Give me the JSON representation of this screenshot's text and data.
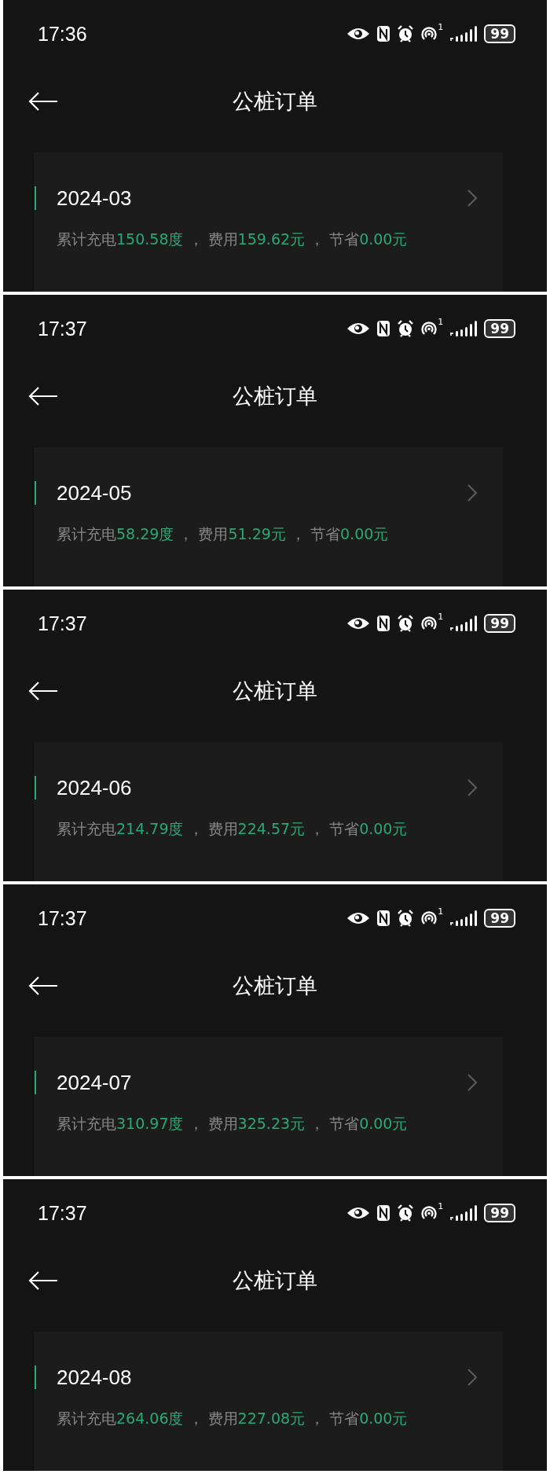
{
  "screens": [
    {
      "status_bar": {
        "time": "17:36",
        "hotspot_count": "1",
        "battery": "99"
      },
      "title": "公桩订单",
      "order": {
        "month": "2024-03",
        "summary": [
          {
            "kind": "label",
            "text": "累计充电"
          },
          {
            "kind": "value",
            "text": "150.58度"
          },
          {
            "kind": "label",
            "text": " ， 费用"
          },
          {
            "kind": "value",
            "text": "159.62元"
          },
          {
            "kind": "label",
            "text": " ， 节省"
          },
          {
            "kind": "value",
            "text": "0.00元"
          }
        ]
      }
    },
    {
      "status_bar": {
        "time": "17:37",
        "hotspot_count": "1",
        "battery": "99"
      },
      "title": "公桩订单",
      "order": {
        "month": "2024-05",
        "summary": [
          {
            "kind": "label",
            "text": "累计充电"
          },
          {
            "kind": "value",
            "text": "58.29度"
          },
          {
            "kind": "label",
            "text": " ， 费用"
          },
          {
            "kind": "value",
            "text": "51.29元"
          },
          {
            "kind": "label",
            "text": " ， 节省"
          },
          {
            "kind": "value",
            "text": "0.00元"
          }
        ]
      }
    },
    {
      "status_bar": {
        "time": "17:37",
        "hotspot_count": "1",
        "battery": "99"
      },
      "title": "公桩订单",
      "order": {
        "month": "2024-06",
        "summary": [
          {
            "kind": "label",
            "text": "累计充电"
          },
          {
            "kind": "value",
            "text": "214.79度"
          },
          {
            "kind": "label",
            "text": " ， 费用"
          },
          {
            "kind": "value",
            "text": "224.57元"
          },
          {
            "kind": "label",
            "text": " ， 节省"
          },
          {
            "kind": "value",
            "text": "0.00元"
          }
        ]
      }
    },
    {
      "status_bar": {
        "time": "17:37",
        "hotspot_count": "1",
        "battery": "99"
      },
      "title": "公桩订单",
      "order": {
        "month": "2024-07",
        "summary": [
          {
            "kind": "label",
            "text": "累计充电"
          },
          {
            "kind": "value",
            "text": "310.97度"
          },
          {
            "kind": "label",
            "text": " ， 费用"
          },
          {
            "kind": "value",
            "text": "325.23元"
          },
          {
            "kind": "label",
            "text": " ， 节省"
          },
          {
            "kind": "value",
            "text": "0.00元"
          }
        ]
      }
    },
    {
      "status_bar": {
        "time": "17:37",
        "hotspot_count": "1",
        "battery": "99"
      },
      "title": "公桩订单",
      "order": {
        "month": "2024-08",
        "summary": [
          {
            "kind": "label",
            "text": "累计充电"
          },
          {
            "kind": "value",
            "text": "264.06度"
          },
          {
            "kind": "label",
            "text": " ， 费用"
          },
          {
            "kind": "value",
            "text": "227.08元"
          },
          {
            "kind": "label",
            "text": " ， 节省"
          },
          {
            "kind": "value",
            "text": "0.00元"
          }
        ]
      }
    }
  ]
}
